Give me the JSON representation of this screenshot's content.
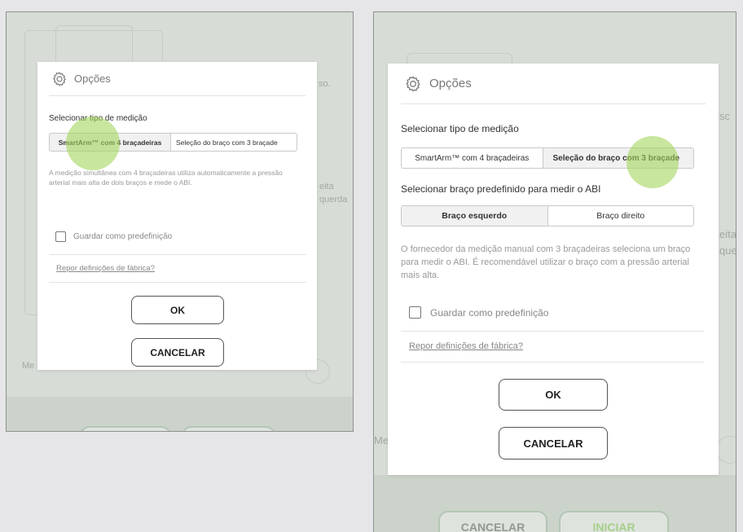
{
  "left": {
    "background": {
      "fragment_top_right": "so.",
      "fragment_mid_right_1": "eita",
      "fragment_mid_right_2": "querda",
      "fragment_bottom_left": "Me"
    },
    "dialog": {
      "title": "Opções",
      "icon": "gear-icon",
      "measurement_type_label": "Selecionar tipo de medição",
      "segment": [
        "SmartArm™ com 4 braçadeiras",
        "Seleção do braço com 3 braçade"
      ],
      "selected_index": 0,
      "description": "A medição simultânea com 4 braçadeiras utiliza automaticamente a pressão arterial mais alta de dois braços e mede o ABI.",
      "save_default_label": "Guardar como predefinição",
      "reset_link": "Repor definições de fábrica?",
      "ok_label": "OK",
      "cancel_label": "CANCELAR"
    }
  },
  "right": {
    "background": {
      "fragment_top_right": "sc",
      "fragment_mid_right_1": "eita",
      "fragment_mid_right_2": "que",
      "fragment_bottom_left": "Me",
      "cancel_button": "CANCELAR",
      "start_button": "INICIAR"
    },
    "dialog": {
      "title": "Opções",
      "icon": "gear-icon",
      "measurement_type_label": "Selecionar tipo de medição",
      "segment": [
        "SmartArm™ com 4 braçadeiras",
        "Seleção do braço com 3 braçade"
      ],
      "selected_index": 1,
      "arm_label": "Selecionar braço predefinido para medir o ABI",
      "arm_segment": [
        "Braço esquerdo",
        "Braço direito"
      ],
      "arm_selected_index": 0,
      "description": "O fornecedor da medição manual com 3 braçadeiras seleciona um braço para medir o ABI. É recomendável utilizar o braço com a pressão arterial mais alta.",
      "save_default_label": "Guardar como predefinição",
      "reset_link": "Repor definições de fábrica?",
      "ok_label": "OK",
      "cancel_label": "CANCELAR"
    }
  },
  "colors": {
    "backdrop": "#d7dcd6",
    "touch_indicator": "#a3d65c",
    "page_background": "#e6e6e9"
  }
}
